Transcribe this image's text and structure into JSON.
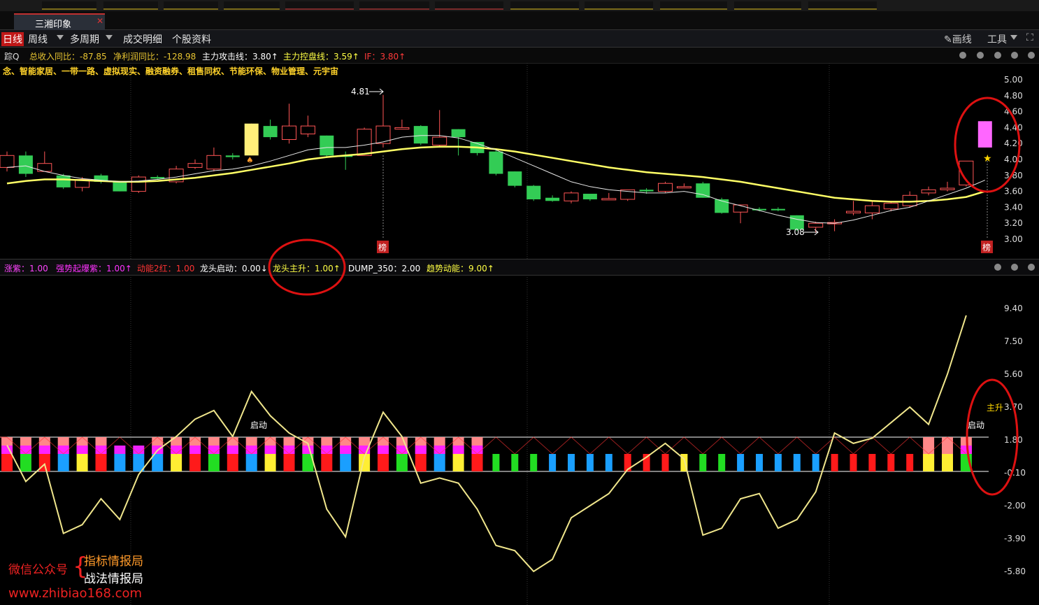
{
  "tab": {
    "title": "三湘印象"
  },
  "menu": {
    "items": [
      "日线",
      "周线",
      "多周期",
      "成交明细",
      "个股资料"
    ],
    "draw_label": "画线",
    "tools_label": "工具"
  },
  "info": {
    "prefix": "踪Q",
    "items": [
      {
        "text": "总收入同比：-87.85",
        "color": "#e8c531"
      },
      {
        "text": "净利润同比：-128.98",
        "color": "#e8c531"
      },
      {
        "text": "主力攻击线：3.80↑",
        "color": "#ffffff"
      },
      {
        "text": "主力控盘线：3.59↑",
        "color": "#ffff44"
      },
      {
        "text": "IF：3.80↑",
        "color": "#ff3a3a"
      }
    ]
  },
  "concepts": "念、智能家居、一带一路、虚拟现实、融资融券、租售同权、节能环保、物业管理、元宇宙",
  "price_axis": [
    "5.00",
    "4.80",
    "4.60",
    "4.40",
    "4.20",
    "4.00",
    "3.80",
    "3.60",
    "3.40",
    "3.20",
    "3.00"
  ],
  "price_annotations": {
    "high": "4.81",
    "low": "3.08",
    "bang": "榜"
  },
  "indicator_bar": [
    {
      "text": "涨紫：1.00",
      "color": "#ff44ff"
    },
    {
      "text": "强势起爆紫：1.00↑",
      "color": "#ff33ff"
    },
    {
      "text": "动能2红：1.00",
      "color": "#ff3333"
    },
    {
      "text": "龙头启动：0.00↓",
      "color": "#ffffff"
    },
    {
      "text": "龙头主升：1.00↑",
      "color": "#ffff44"
    },
    {
      "text": "DUMP_350：2.00",
      "color": "#ffffff"
    },
    {
      "text": "趋势动能：9.00↑",
      "color": "#ffff44"
    }
  ],
  "indicator_axis": [
    "9.40",
    "7.50",
    "5.60",
    "3.70",
    "1.80",
    "-0.10",
    "-2.00",
    "-3.90",
    "-5.80"
  ],
  "indicator_labels": {
    "start": "启动",
    "start2": "启动",
    "main_rise": "主升"
  },
  "watermark": {
    "left": "微信公众号",
    "right_top": "指标情报局",
    "right_bottom": "战法情报局",
    "url": "www.zhibiao168.com"
  },
  "colors": {
    "up": "#ff4444",
    "down": "#33cc55",
    "ma_short": "#ffffff",
    "ma_long": "#ffff66",
    "highlight": "#dd1111"
  },
  "chart_data": {
    "type": "candlestick",
    "y_range": [
      3.0,
      5.0
    ],
    "candles": [
      {
        "o": 3.9,
        "h": 4.1,
        "l": 3.85,
        "c": 4.05,
        "dir": "up"
      },
      {
        "o": 4.05,
        "h": 4.1,
        "l": 3.78,
        "c": 3.82,
        "dir": "down"
      },
      {
        "o": 3.85,
        "h": 4.1,
        "l": 3.85,
        "c": 3.95,
        "dir": "up"
      },
      {
        "o": 3.8,
        "h": 3.82,
        "l": 3.63,
        "c": 3.65,
        "dir": "down"
      },
      {
        "o": 3.65,
        "h": 3.78,
        "l": 3.6,
        "c": 3.75,
        "dir": "up"
      },
      {
        "o": 3.8,
        "h": 3.82,
        "l": 3.7,
        "c": 3.72,
        "dir": "down"
      },
      {
        "o": 3.72,
        "h": 3.73,
        "l": 3.6,
        "c": 3.6,
        "dir": "down"
      },
      {
        "o": 3.6,
        "h": 3.8,
        "l": 3.58,
        "c": 3.78,
        "dir": "up"
      },
      {
        "o": 3.78,
        "h": 3.8,
        "l": 3.75,
        "c": 3.76,
        "dir": "down"
      },
      {
        "o": 3.72,
        "h": 3.92,
        "l": 3.7,
        "c": 3.88,
        "dir": "up"
      },
      {
        "o": 3.9,
        "h": 4.0,
        "l": 3.88,
        "c": 3.95,
        "dir": "up"
      },
      {
        "o": 3.88,
        "h": 4.15,
        "l": 3.85,
        "c": 4.05,
        "dir": "up"
      },
      {
        "o": 4.05,
        "h": 4.08,
        "l": 4.0,
        "c": 4.03,
        "dir": "down"
      },
      {
        "o": 4.05,
        "h": 4.45,
        "l": 4.05,
        "c": 4.45,
        "dir": "up",
        "special": true
      },
      {
        "o": 4.42,
        "h": 4.5,
        "l": 4.25,
        "c": 4.28,
        "dir": "down"
      },
      {
        "o": 4.25,
        "h": 4.7,
        "l": 4.2,
        "c": 4.42,
        "dir": "up"
      },
      {
        "o": 4.32,
        "h": 4.55,
        "l": 4.28,
        "c": 4.42,
        "dir": "up"
      },
      {
        "o": 4.3,
        "h": 4.3,
        "l": 4.02,
        "c": 4.05,
        "dir": "down"
      },
      {
        "o": 4.05,
        "h": 4.1,
        "l": 3.87,
        "c": 4.05,
        "dir": "down"
      },
      {
        "o": 4.05,
        "h": 4.4,
        "l": 4.05,
        "c": 4.38,
        "dir": "up"
      },
      {
        "o": 4.2,
        "h": 4.81,
        "l": 4.15,
        "c": 4.42,
        "dir": "up"
      },
      {
        "o": 4.38,
        "h": 4.5,
        "l": 4.38,
        "c": 4.4,
        "dir": "up"
      },
      {
        "o": 4.42,
        "h": 4.43,
        "l": 4.18,
        "c": 4.2,
        "dir": "down"
      },
      {
        "o": 4.18,
        "h": 4.62,
        "l": 4.15,
        "c": 4.28,
        "dir": "up"
      },
      {
        "o": 4.38,
        "h": 4.38,
        "l": 4.05,
        "c": 4.28,
        "dir": "down"
      },
      {
        "o": 4.22,
        "h": 4.22,
        "l": 4.05,
        "c": 4.08,
        "dir": "down"
      },
      {
        "o": 4.1,
        "h": 4.12,
        "l": 3.8,
        "c": 3.82,
        "dir": "down"
      },
      {
        "o": 3.85,
        "h": 3.85,
        "l": 3.65,
        "c": 3.67,
        "dir": "down"
      },
      {
        "o": 3.67,
        "h": 3.68,
        "l": 3.48,
        "c": 3.5,
        "dir": "down"
      },
      {
        "o": 3.52,
        "h": 3.55,
        "l": 3.47,
        "c": 3.48,
        "dir": "down"
      },
      {
        "o": 3.48,
        "h": 3.6,
        "l": 3.45,
        "c": 3.58,
        "dir": "up"
      },
      {
        "o": 3.57,
        "h": 3.57,
        "l": 3.48,
        "c": 3.5,
        "dir": "down"
      },
      {
        "o": 3.5,
        "h": 3.58,
        "l": 3.49,
        "c": 3.51,
        "dir": "up"
      },
      {
        "o": 3.5,
        "h": 3.62,
        "l": 3.48,
        "c": 3.62,
        "dir": "up"
      },
      {
        "o": 3.62,
        "h": 3.64,
        "l": 3.57,
        "c": 3.6,
        "dir": "down"
      },
      {
        "o": 3.6,
        "h": 3.72,
        "l": 3.58,
        "c": 3.7,
        "dir": "up"
      },
      {
        "o": 3.66,
        "h": 3.7,
        "l": 3.64,
        "c": 3.66,
        "dir": "up"
      },
      {
        "o": 3.7,
        "h": 3.72,
        "l": 3.52,
        "c": 3.52,
        "dir": "down"
      },
      {
        "o": 3.5,
        "h": 3.52,
        "l": 3.32,
        "c": 3.33,
        "dir": "down"
      },
      {
        "o": 3.34,
        "h": 3.43,
        "l": 3.2,
        "c": 3.43,
        "dir": "up"
      },
      {
        "o": 3.38,
        "h": 3.4,
        "l": 3.35,
        "c": 3.37,
        "dir": "down"
      },
      {
        "o": 3.38,
        "h": 3.4,
        "l": 3.35,
        "c": 3.37,
        "dir": "down"
      },
      {
        "o": 3.3,
        "h": 3.3,
        "l": 3.1,
        "c": 3.12,
        "dir": "down"
      },
      {
        "o": 3.15,
        "h": 3.22,
        "l": 3.08,
        "c": 3.2,
        "dir": "up"
      },
      {
        "o": 3.21,
        "h": 3.25,
        "l": 3.1,
        "c": 3.21,
        "dir": "up"
      },
      {
        "o": 3.33,
        "h": 3.48,
        "l": 3.3,
        "c": 3.35,
        "dir": "up"
      },
      {
        "o": 3.33,
        "h": 3.48,
        "l": 3.25,
        "c": 3.42,
        "dir": "up"
      },
      {
        "o": 3.38,
        "h": 3.48,
        "l": 3.35,
        "c": 3.45,
        "dir": "up"
      },
      {
        "o": 3.42,
        "h": 3.6,
        "l": 3.4,
        "c": 3.55,
        "dir": "up"
      },
      {
        "o": 3.58,
        "h": 3.66,
        "l": 3.55,
        "c": 3.62,
        "dir": "up"
      },
      {
        "o": 3.62,
        "h": 3.72,
        "l": 3.6,
        "c": 3.64,
        "dir": "up"
      },
      {
        "o": 3.68,
        "h": 3.98,
        "l": 3.66,
        "c": 3.98,
        "dir": "up"
      },
      {
        "o": 4.15,
        "h": 4.48,
        "l": 4.15,
        "c": 4.48,
        "dir": "up",
        "special": true
      }
    ],
    "ma_short": [
      3.9,
      3.92,
      3.85,
      3.8,
      3.76,
      3.74,
      3.72,
      3.73,
      3.75,
      3.78,
      3.82,
      3.86,
      3.88,
      3.92,
      3.98,
      4.05,
      4.12,
      4.15,
      4.15,
      4.18,
      4.22,
      4.28,
      4.3,
      4.3,
      4.27,
      4.2,
      4.12,
      4.02,
      3.92,
      3.82,
      3.72,
      3.66,
      3.62,
      3.6,
      3.58,
      3.58,
      3.6,
      3.56,
      3.48,
      3.42,
      3.36,
      3.3,
      3.25,
      3.21,
      3.2,
      3.24,
      3.3,
      3.36,
      3.4,
      3.48,
      3.56,
      3.64,
      3.74
    ],
    "ma_long": [
      3.7,
      3.73,
      3.75,
      3.75,
      3.74,
      3.73,
      3.72,
      3.72,
      3.73,
      3.75,
      3.77,
      3.8,
      3.83,
      3.87,
      3.91,
      3.95,
      4.0,
      4.03,
      4.05,
      4.07,
      4.1,
      4.13,
      4.15,
      4.16,
      4.16,
      4.15,
      4.13,
      4.1,
      4.06,
      4.02,
      3.98,
      3.94,
      3.9,
      3.87,
      3.84,
      3.82,
      3.8,
      3.78,
      3.75,
      3.72,
      3.68,
      3.64,
      3.6,
      3.56,
      3.52,
      3.5,
      3.48,
      3.47,
      3.47,
      3.48,
      3.5,
      3.53,
      3.6
    ],
    "trend_line": [
      1.5,
      -0.6,
      0.4,
      -3.6,
      -3.1,
      -1.6,
      -2.8,
      -0.2,
      1.2,
      2.0,
      3.0,
      3.5,
      2.0,
      4.6,
      3.2,
      2.2,
      1.6,
      -2.2,
      -3.8,
      0.8,
      3.4,
      2.0,
      -0.7,
      -0.4,
      -0.7,
      -2.2,
      -4.3,
      -4.6,
      -5.8,
      -5.1,
      -2.7,
      -2.0,
      -1.3,
      0.1,
      0.8,
      1.6,
      0.7,
      -3.7,
      -3.3,
      -1.6,
      -1.3,
      -3.3,
      -2.8,
      -1.2,
      2.2,
      1.6,
      1.9,
      2.8,
      3.7,
      2.7,
      5.6,
      9.0
    ],
    "bar_colors": [
      "mix",
      "mix",
      "mix",
      "mix",
      "mix",
      "mix",
      "mag",
      "mag",
      "mix",
      "mix",
      "mix",
      "mix",
      "mix",
      "mix",
      "mix",
      "mix",
      "mix",
      "mix",
      "mix",
      "mix",
      "mix",
      "mix",
      "mix",
      "mix",
      "mix",
      "mix",
      "g",
      "g",
      "g",
      "b",
      "b",
      "b",
      "b",
      "r",
      "r",
      "r",
      "y",
      "g",
      "g",
      "b",
      "b",
      "b",
      "b",
      "b",
      "r",
      "r",
      "r",
      "r",
      "r",
      "pink",
      "pink",
      "mix"
    ]
  }
}
